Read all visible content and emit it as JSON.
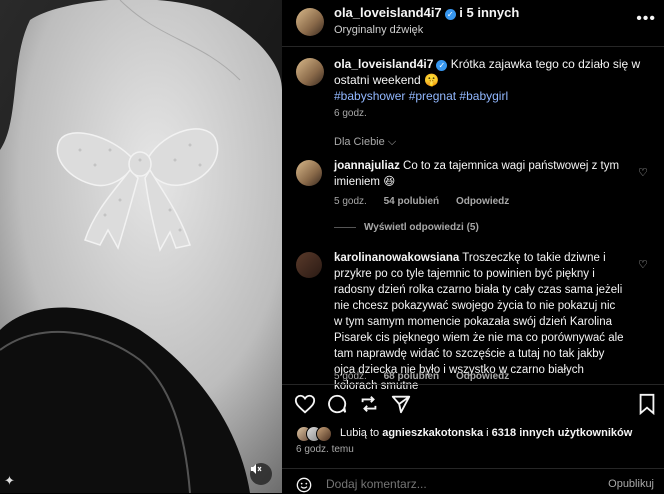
{
  "header": {
    "username": "ola_loveisland4i7",
    "and_others": "i 5 innych",
    "audio": "Oryginalny dźwięk",
    "more_icon": "more-dots"
  },
  "caption": {
    "username": "ola_loveisland4i7",
    "text": "Krótka zajawka tego co działo się w ostatni weekend 🤫",
    "tags": "#babyshower #pregnat #babygirl",
    "time": "6 godz."
  },
  "for_you": "Dla Ciebie",
  "comments": [
    {
      "username": "joannajuliaz",
      "text": "Co to za tajemnica wagi państwowej z tym imieniem 😆",
      "time": "5 godz.",
      "likes": "54 polubień",
      "reply": "Odpowiedz"
    },
    {
      "username": "karolinanowakowsiana",
      "text": "Troszeczkę to takie dziwne i przykre po co tyle tajemnic to powinien być piękny i radosny dzień rolka czarno biała ty cały czas sama jeżeli nie chcesz pokazywać swojego życia to nie pokazuj nic w tym samym momencie pokazała swój dzień Karolina Pisarek cis pięknego wiem że nie ma co porównywać ale tam naprawdę widać to szczęście a tutaj no tak jakby ojca dziecka nie było i wszystko w czarno białych kolorach smutne",
      "time": "5 godz.",
      "likes": "68 polubień",
      "reply": "Odpowiedz"
    }
  ],
  "view_replies": "Wyświetl odpowiedzi (5)",
  "likes_line": {
    "prefix": "Lubią to",
    "user": "agnieszkakotonska",
    "middle": "i",
    "others": "6318 innych użytkowników"
  },
  "post_time": "6 godz. temu",
  "add_comment": {
    "placeholder": "Dodaj komentarz...",
    "publish": "Opublikuj"
  },
  "colors": {
    "background": "#000000",
    "link": "#92b8ff",
    "verified": "#3797f0",
    "muted_text": "#a8a8a8"
  }
}
